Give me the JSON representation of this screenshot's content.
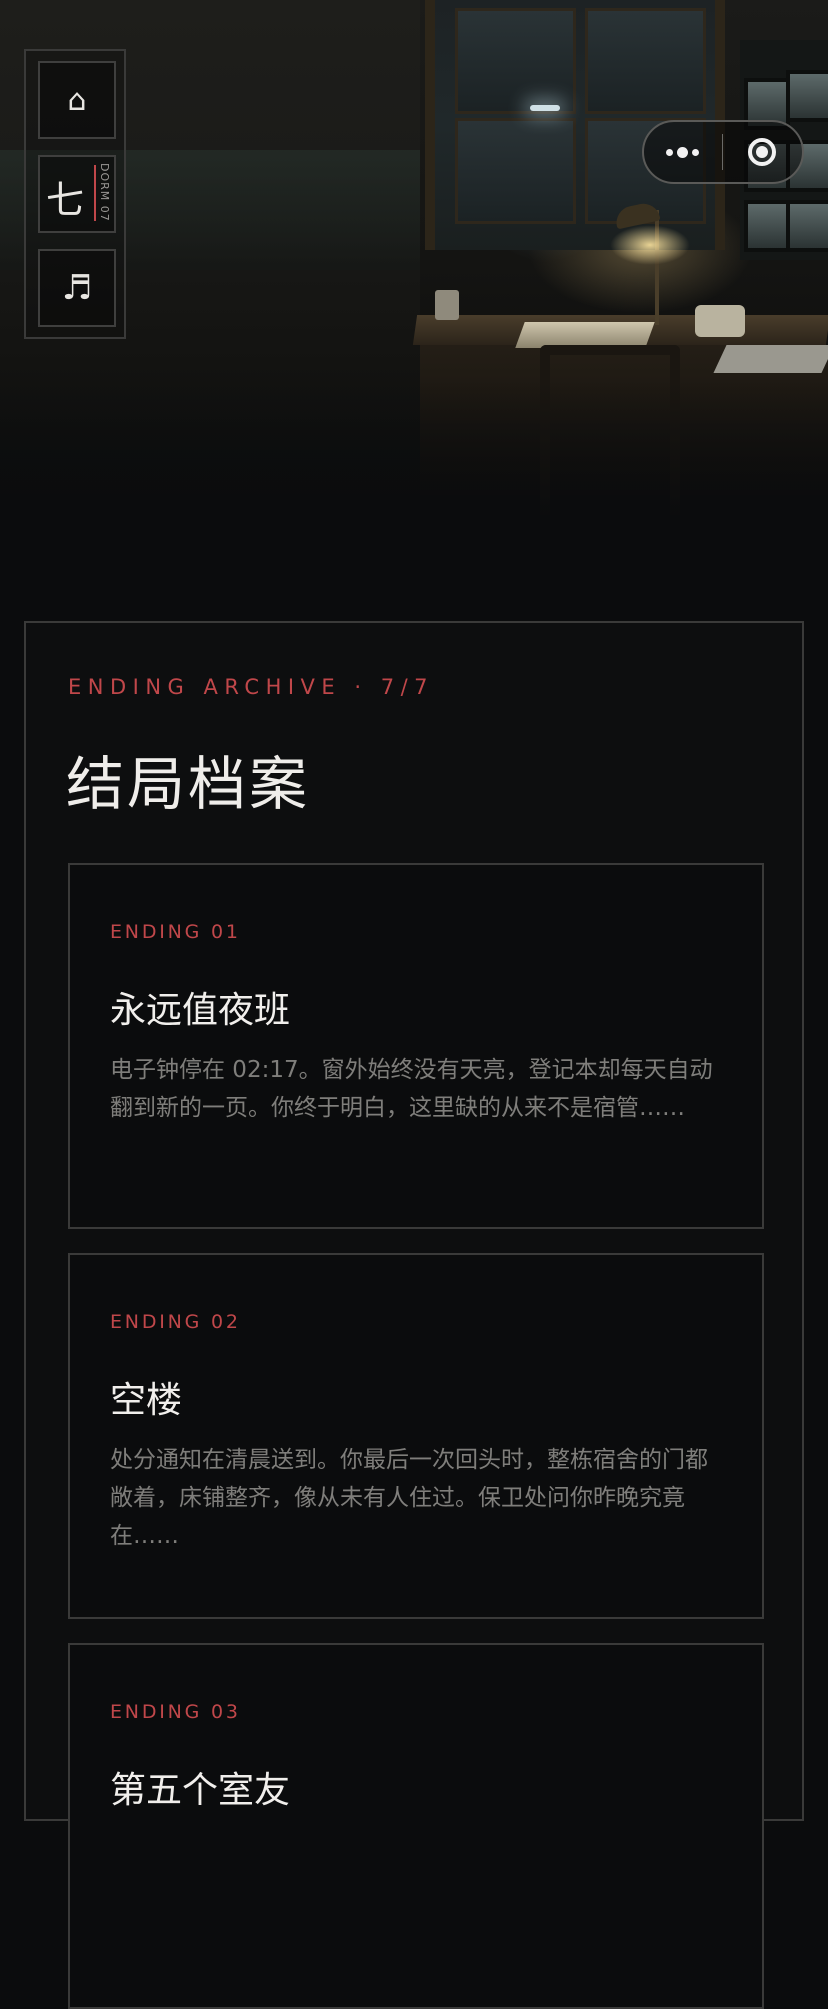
{
  "capsule": {
    "more_icon": "more-dots-icon",
    "close_icon": "target-close-icon"
  },
  "side_nav": {
    "home_icon": "⌂",
    "dorm_char": "七",
    "dorm_label": "DORM",
    "dorm_number": "07",
    "music_icon": "♬"
  },
  "archive": {
    "eyebrow": "ENDING ARCHIVE · 7/7",
    "title": "结局档案",
    "endings": [
      {
        "number": "ENDING 01",
        "title": "永远值夜班",
        "text": "电子钟停在 02:17。窗外始终没有天亮，登记本却每天自动翻到新的一页。你终于明白，这里缺的从来不是宿管……"
      },
      {
        "number": "ENDING 02",
        "title": "空楼",
        "text": "处分通知在清晨送到。你最后一次回头时，整栋宿舍的门都敞着，床铺整齐，像从未有人住过。保卫处问你昨晚究竟在……"
      },
      {
        "number": "ENDING 03",
        "title": "第五个室友",
        "text": ""
      }
    ]
  },
  "colors": {
    "accent": "#c0474a",
    "background": "#0b0c0d",
    "border": "#3a3a39"
  }
}
